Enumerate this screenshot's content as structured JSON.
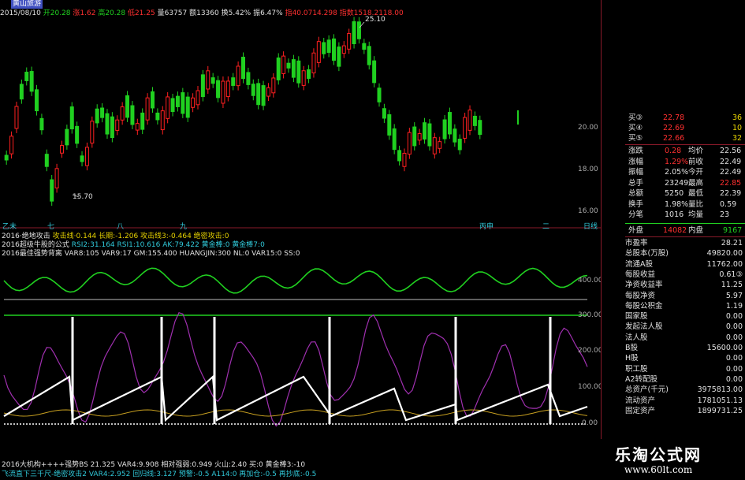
{
  "header": {
    "stock_name": "黄山旅游",
    "date": "2015/08/10",
    "open": "开20.28",
    "change": "涨1.62",
    "high": "高20.28",
    "low": "低21.25",
    "volume": "量63757",
    "amount": "额13360",
    "turnover": "换5.42%",
    "amplitude": "振6.47%",
    "index_a": "指40.0714.298",
    "index_b": "指数1518.2118.00"
  },
  "main_chart": {
    "max_label": "25.10",
    "min_label": "15.70",
    "y_ticks": [
      "20.00",
      "18.00",
      "16.00"
    ],
    "x_labels": [
      "乙未",
      "七",
      "八",
      "九",
      "丙申",
      "二",
      "日线"
    ]
  },
  "indicator_lines": [
    {
      "name": "2016·绝地攻击",
      "values": "攻击线·0.144  长期:-1.206  攻击线3:-0.464  绝密攻击:0"
    },
    {
      "name": "2016超级牛股的公式",
      "values": "RSI2:31.164  RSI1:10.616  AK:79.422  黄金棒:0  黄金棒7:0"
    },
    {
      "name": "2016最佳强势背离",
      "values": "VAR8:105  VAR9:17  GM:155.400  HUANGJIN:300  NL:0  VAR15:0  SS:0"
    }
  ],
  "sub_chart": {
    "y_ticks": [
      "400.00",
      "300.00",
      "200.00",
      "100.00",
      "0.00"
    ]
  },
  "footer": [
    {
      "text": "2016大机构++++强势BS    21.325  VAR4:9.908  相对强弱:0.949  火山:2.40  买:0  黄金棒3:-10"
    },
    {
      "text": "飞流直下三千尺-绝密攻击2    VAR4:2.952  回归线:3.127  预警:-0.5  A114:0  再加仓:-0.5  再抄底:-0.5"
    }
  ],
  "quote_panel": {
    "buys": [
      {
        "label": "买③",
        "price": "22.78",
        "vol": "36"
      },
      {
        "label": "买④",
        "price": "22.69",
        "vol": "10"
      },
      {
        "label": "买⑤",
        "price": "22.66",
        "vol": "32"
      }
    ],
    "stats": [
      {
        "k1": "涨跌",
        "v1": "0.28",
        "k2": "均价",
        "v2": "22.56"
      },
      {
        "k1": "涨幅",
        "v1": "1.29%",
        "k2": "前收",
        "v2": "22.49"
      },
      {
        "k1": "振幅",
        "v1": "2.05%",
        "k2": "今开",
        "v2": "22.49"
      },
      {
        "k1": "总手",
        "v1": "23249",
        "k2": "最高",
        "v2": "22.85"
      },
      {
        "k1": "总额",
        "v1": "5250",
        "k2": "最低",
        "v2": "22.39"
      },
      {
        "k1": "换手",
        "v1": "1.98%",
        "k2": "量比",
        "v2": "0.59"
      },
      {
        "k1": "分笔",
        "v1": "1016",
        "k2": "均量",
        "v2": "23"
      }
    ],
    "outer": {
      "k1": "外盘",
      "v1": "14082",
      "k2": "内盘",
      "v2": "9167"
    },
    "finance": [
      {
        "k": "市盈率",
        "v": "28.21"
      },
      {
        "k": "总股本(万股)",
        "v": "49820.00"
      },
      {
        "k": "流通A股",
        "v": "11762.00"
      },
      {
        "k": "每股收益",
        "v": "0.61③"
      },
      {
        "k": "净资收益率",
        "v": "11.25"
      },
      {
        "k": "每股净资",
        "v": "5.97"
      },
      {
        "k": "每股公积金",
        "v": "1.19"
      },
      {
        "k": "国家股",
        "v": "0.00"
      },
      {
        "k": "发起法人股",
        "v": "0.00"
      },
      {
        "k": "法人股",
        "v": "0.00"
      },
      {
        "k": "B股",
        "v": "15600.00"
      },
      {
        "k": "H股",
        "v": "0.00"
      },
      {
        "k": "职工股",
        "v": "0.00"
      },
      {
        "k": "A2转配股",
        "v": "0.00"
      },
      {
        "k": "总资产(千元)",
        "v": "3975813.00"
      },
      {
        "k": "流动资产",
        "v": "1781051.13"
      },
      {
        "k": "固定资产",
        "v": "1899731.25"
      }
    ]
  },
  "watermark": {
    "title": "乐淘公式网",
    "url": "www.60lt.com"
  }
}
